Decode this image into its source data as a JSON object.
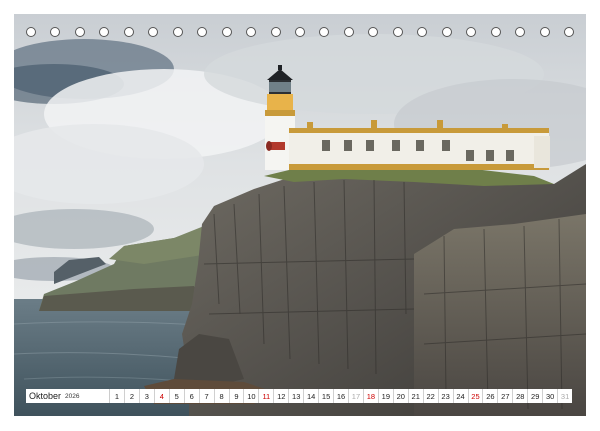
{
  "calendar": {
    "month": "Oktober",
    "year": "2026",
    "days": [
      {
        "n": "1",
        "type": "normal"
      },
      {
        "n": "2",
        "type": "normal"
      },
      {
        "n": "3",
        "type": "normal"
      },
      {
        "n": "4",
        "type": "sunday"
      },
      {
        "n": "5",
        "type": "normal"
      },
      {
        "n": "6",
        "type": "normal"
      },
      {
        "n": "7",
        "type": "normal"
      },
      {
        "n": "8",
        "type": "normal"
      },
      {
        "n": "9",
        "type": "normal"
      },
      {
        "n": "10",
        "type": "normal"
      },
      {
        "n": "11",
        "type": "sunday"
      },
      {
        "n": "12",
        "type": "normal"
      },
      {
        "n": "13",
        "type": "normal"
      },
      {
        "n": "14",
        "type": "normal"
      },
      {
        "n": "15",
        "type": "normal"
      },
      {
        "n": "16",
        "type": "normal"
      },
      {
        "n": "17",
        "type": "trailing"
      },
      {
        "n": "18",
        "type": "sunday"
      },
      {
        "n": "19",
        "type": "normal"
      },
      {
        "n": "20",
        "type": "normal"
      },
      {
        "n": "21",
        "type": "normal"
      },
      {
        "n": "22",
        "type": "normal"
      },
      {
        "n": "23",
        "type": "normal"
      },
      {
        "n": "24",
        "type": "normal"
      },
      {
        "n": "25",
        "type": "sunday"
      },
      {
        "n": "26",
        "type": "normal"
      },
      {
        "n": "27",
        "type": "normal"
      },
      {
        "n": "28",
        "type": "normal"
      },
      {
        "n": "29",
        "type": "normal"
      },
      {
        "n": "30",
        "type": "normal"
      },
      {
        "n": "31",
        "type": "trailing"
      }
    ]
  },
  "colors": {
    "sunday": "#cc0000",
    "trailing": "#aaaaaa",
    "text": "#222222"
  },
  "photo": {
    "subject": "lighthouse-on-sea-cliff"
  }
}
